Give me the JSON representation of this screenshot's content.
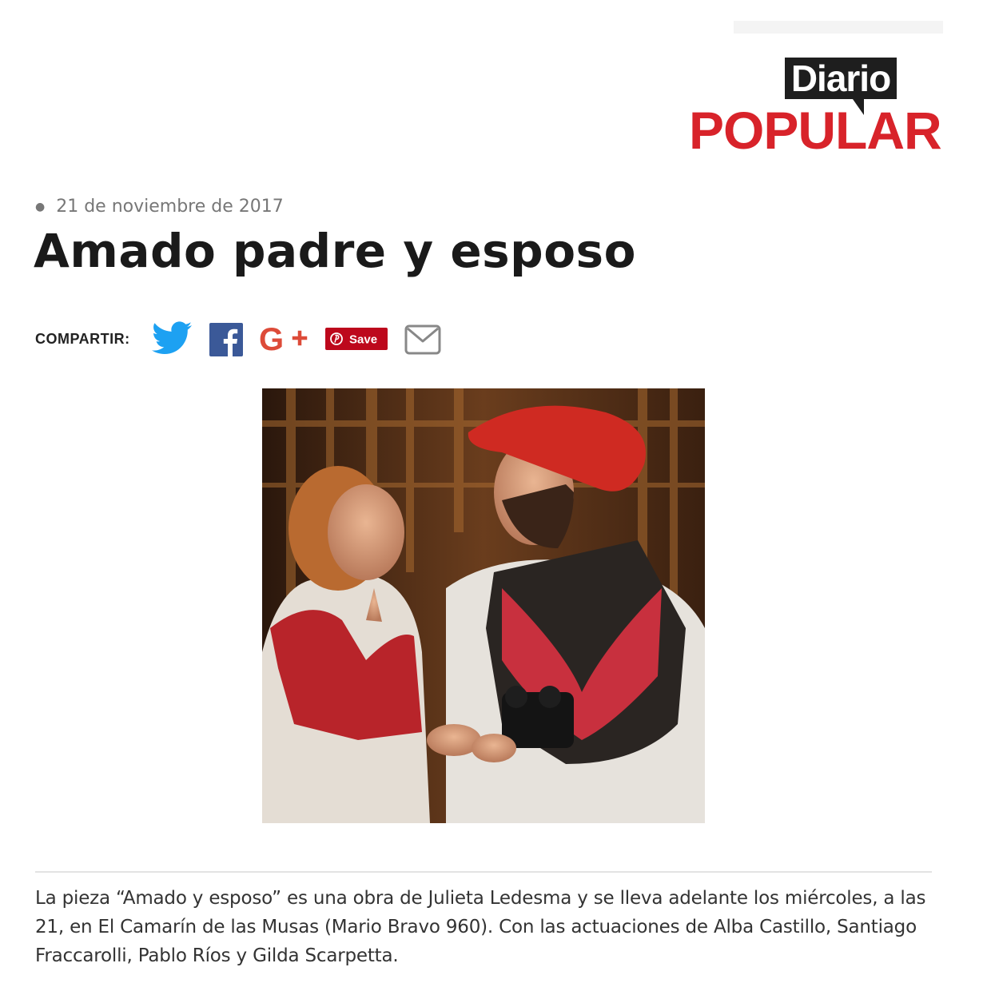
{
  "header": {
    "logo_top": "Diario",
    "logo_bottom": "POPULAR"
  },
  "article": {
    "date": "21 de noviembre de 2017",
    "title": "Amado padre y esposo",
    "body": "La pieza “Amado y esposo” es una obra de Julieta Ledesma y se lleva adelante los miércoles, a las 21, en El Camarín de las Musas (Mario Bravo 960). Con las actuaciones de Alba Castillo, Santiago Fraccarolli, Pablo Ríos y Gilda Scarpetta."
  },
  "share": {
    "label": "COMPARTIR:",
    "buttons": [
      {
        "name": "twitter",
        "icon": "twitter-bird-icon",
        "color": "#1da1f2"
      },
      {
        "name": "facebook",
        "icon": "facebook-f-icon",
        "color": "#3b5998"
      },
      {
        "name": "google-plus",
        "icon": "google-plus-icon",
        "color": "#dd4b39"
      },
      {
        "name": "pinterest",
        "icon": "pinterest-icon",
        "label": "Save",
        "color": "#bd081c"
      },
      {
        "name": "email",
        "icon": "envelope-icon",
        "color": "#888888"
      }
    ]
  },
  "colors": {
    "brand_red": "#d8232a",
    "brand_dark": "#1e1e1e",
    "text": "#333333"
  }
}
